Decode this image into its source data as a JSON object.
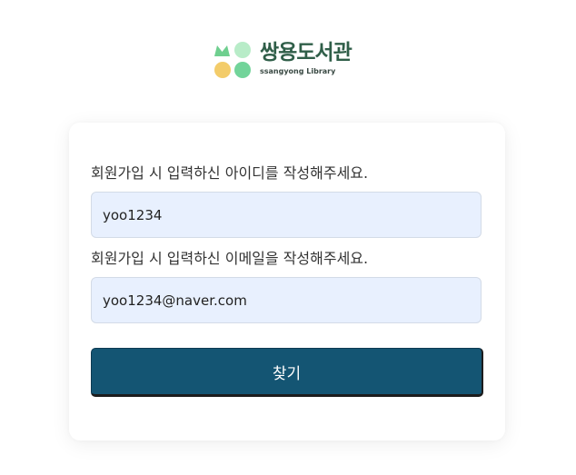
{
  "logo": {
    "name": "쌍용도서관",
    "subtitle": "ssangyong Library",
    "mark_icon": "library-leaf-dots-icon",
    "colors": {
      "leaf": "#6fcf8f",
      "leaf_light": "#b8ecc8",
      "dot_yellow": "#f3cc6a",
      "dot_green": "#72d49a",
      "text": "#2f5e48"
    }
  },
  "form": {
    "id_label": "회원가입 시 입력하신 아이디를 작성해주세요.",
    "id_value": "yoo1234",
    "email_label": "회원가입 시 입력하신 이메일을 작성해주세요.",
    "email_value": "yoo1234@naver.com",
    "submit_label": "찾기",
    "colors": {
      "input_bg": "#e8f0fe",
      "button_bg": "#145573",
      "button_text": "#ffffff"
    }
  }
}
